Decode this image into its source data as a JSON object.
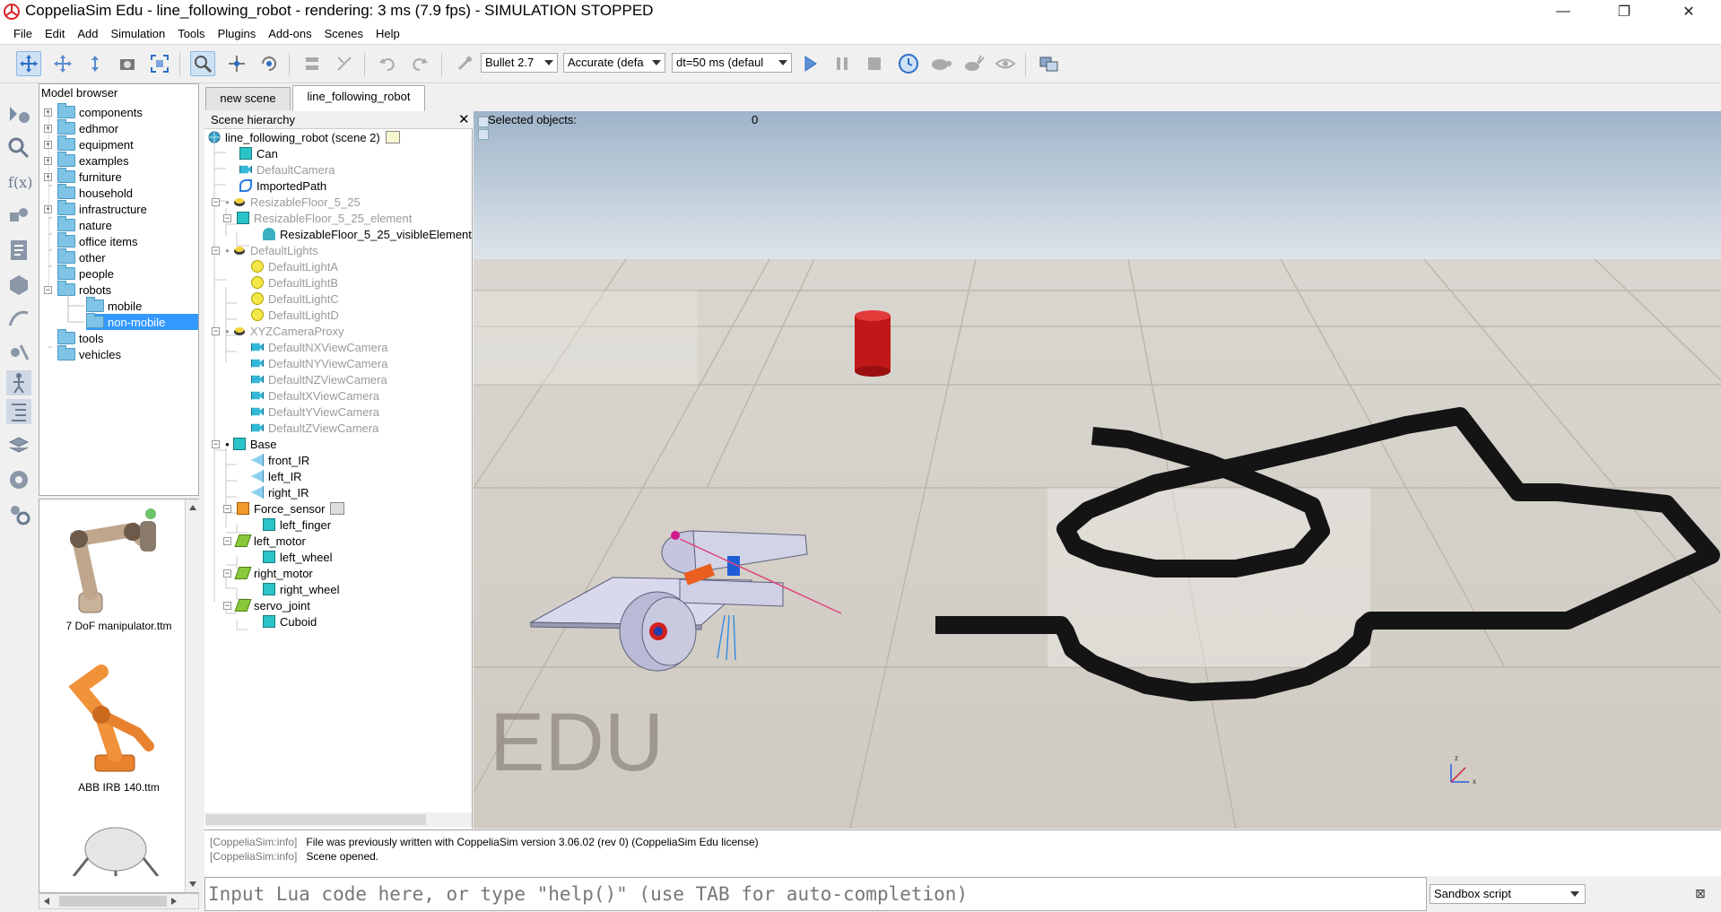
{
  "window": {
    "title": "CoppeliaSim Edu - line_following_robot - rendering: 3 ms (7.9 fps) - SIMULATION STOPPED",
    "minimize": "—",
    "maximize": "❐",
    "close": "✕"
  },
  "menu": [
    "File",
    "Edit",
    "Add",
    "Simulation",
    "Tools",
    "Plugins",
    "Add-ons",
    "Scenes",
    "Help"
  ],
  "toolbar": {
    "engine": "Bullet 2.7",
    "accuracy": "Accurate (defa",
    "timestep": "dt=50 ms (defaul"
  },
  "model_browser": {
    "title": "Model browser",
    "folders": [
      {
        "label": "components",
        "exp": "+"
      },
      {
        "label": "edhmor",
        "exp": "+"
      },
      {
        "label": "equipment",
        "exp": "+"
      },
      {
        "label": "examples",
        "exp": "+"
      },
      {
        "label": "furniture",
        "exp": "+"
      },
      {
        "label": "household",
        "exp": ""
      },
      {
        "label": "infrastructure",
        "exp": "+"
      },
      {
        "label": "nature",
        "exp": ""
      },
      {
        "label": "office items",
        "exp": ""
      },
      {
        "label": "other",
        "exp": ""
      },
      {
        "label": "people",
        "exp": ""
      },
      {
        "label": "robots",
        "exp": "−"
      },
      {
        "label": "mobile",
        "exp": ""
      },
      {
        "label": "non-mobile",
        "exp": ""
      },
      {
        "label": "tools",
        "exp": ""
      },
      {
        "label": "vehicles",
        "exp": ""
      }
    ],
    "selected": "non-mobile",
    "thumbnails": [
      "7 DoF manipulator.ttm",
      "ABB IRB 140.ttm"
    ]
  },
  "tabs": [
    "new scene",
    "line_following_robot"
  ],
  "active_tab": "line_following_robot",
  "hierarchy": {
    "title": "Scene hierarchy",
    "items": [
      {
        "label": "line_following_robot (scene 2)",
        "icon": "scene-icon",
        "dim": false
      },
      {
        "label": "Can",
        "icon": "shape-icon",
        "dim": false
      },
      {
        "label": "DefaultCamera",
        "icon": "camera-icon",
        "dim": true
      },
      {
        "label": "ImportedPath",
        "icon": "path-icon",
        "dim": false
      },
      {
        "label": "ResizableFloor_5_25",
        "icon": "model-icon",
        "dim": true
      },
      {
        "label": "ResizableFloor_5_25_element",
        "icon": "shape-icon",
        "dim": true
      },
      {
        "label": "ResizableFloor_5_25_visibleElement",
        "icon": "visible-icon",
        "dim": false
      },
      {
        "label": "DefaultLights",
        "icon": "model-icon",
        "dim": true
      },
      {
        "label": "DefaultLightA",
        "icon": "light-icon",
        "dim": true
      },
      {
        "label": "DefaultLightB",
        "icon": "light-icon",
        "dim": true
      },
      {
        "label": "DefaultLightC",
        "icon": "light-icon",
        "dim": true
      },
      {
        "label": "DefaultLightD",
        "icon": "light-icon",
        "dim": true
      },
      {
        "label": "XYZCameraProxy",
        "icon": "model-icon",
        "dim": true
      },
      {
        "label": "DefaultNXViewCamera",
        "icon": "camera-icon",
        "dim": true
      },
      {
        "label": "DefaultNYViewCamera",
        "icon": "camera-icon",
        "dim": true
      },
      {
        "label": "DefaultNZViewCamera",
        "icon": "camera-icon",
        "dim": true
      },
      {
        "label": "DefaultXViewCamera",
        "icon": "camera-icon",
        "dim": true
      },
      {
        "label": "DefaultYViewCamera",
        "icon": "camera-icon",
        "dim": true
      },
      {
        "label": "DefaultZViewCamera",
        "icon": "camera-icon",
        "dim": true
      },
      {
        "label": "Base",
        "icon": "shape-icon",
        "dim": false
      },
      {
        "label": "front_IR",
        "icon": "proximity-sensor-icon",
        "dim": false
      },
      {
        "label": "left_IR",
        "icon": "proximity-sensor-icon",
        "dim": false
      },
      {
        "label": "right_IR",
        "icon": "proximity-sensor-icon",
        "dim": false
      },
      {
        "label": "Force_sensor",
        "icon": "force-sensor-icon",
        "dim": false
      },
      {
        "label": "left_finger",
        "icon": "shape-icon",
        "dim": false
      },
      {
        "label": "left_motor",
        "icon": "joint-icon",
        "dim": false
      },
      {
        "label": "left_wheel",
        "icon": "shape-icon",
        "dim": false
      },
      {
        "label": "right_motor",
        "icon": "joint-icon",
        "dim": false
      },
      {
        "label": "right_wheel",
        "icon": "shape-icon",
        "dim": false
      },
      {
        "label": "servo_joint",
        "icon": "joint-icon",
        "dim": false
      },
      {
        "label": "Cuboid",
        "icon": "shape-icon",
        "dim": false
      }
    ]
  },
  "viewport": {
    "selected_label": "Selected objects:",
    "selected_count": "0",
    "watermark": "EDU",
    "axis_z": "z",
    "axis_x": "x"
  },
  "console": {
    "lines": [
      {
        "tag": "[CoppeliaSim:info]",
        "text": "File was previously written with CoppeliaSim version 3.06.02 (rev 0) (CoppeliaSim Edu license)"
      },
      {
        "tag": "[CoppeliaSim:info]",
        "text": "Scene opened."
      }
    ],
    "input_placeholder": "Input Lua code here, or type \"help()\" (use TAB for auto-completion)",
    "script_mode": "Sandbox script"
  }
}
